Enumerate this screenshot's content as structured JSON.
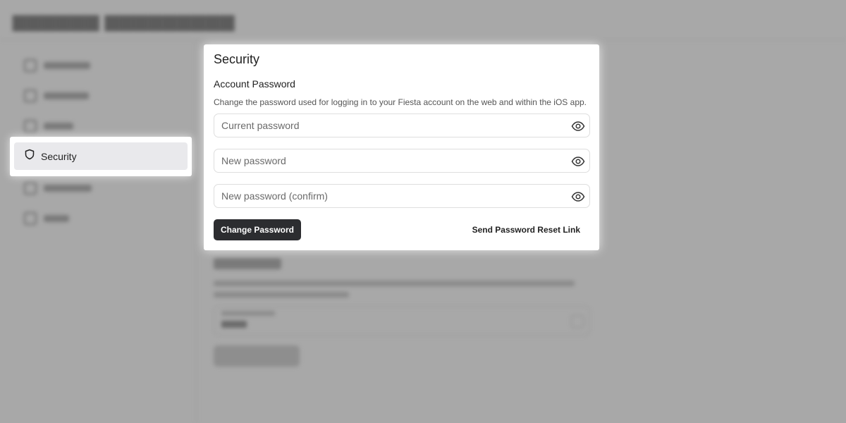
{
  "background": {
    "blurred": true
  },
  "sidebar": {
    "active_item": {
      "label": "Security",
      "icon": "shield-icon"
    }
  },
  "security_panel": {
    "title": "Security",
    "account_password": {
      "heading": "Account Password",
      "description": "Change the password used for logging in to your Fiesta account on the web and within the iOS app.",
      "current_password_placeholder": "Current password",
      "new_password_placeholder": "New password",
      "confirm_password_placeholder": "New password (confirm)",
      "show_password_icon": "eye-icon",
      "change_button_label": "Change Password",
      "reset_link_label": "Send Password Reset Link"
    }
  },
  "colors": {
    "overlay": "#a8a8a8",
    "primary_button": "#2c2d30",
    "active_nav_bg": "#e9e9ec"
  }
}
